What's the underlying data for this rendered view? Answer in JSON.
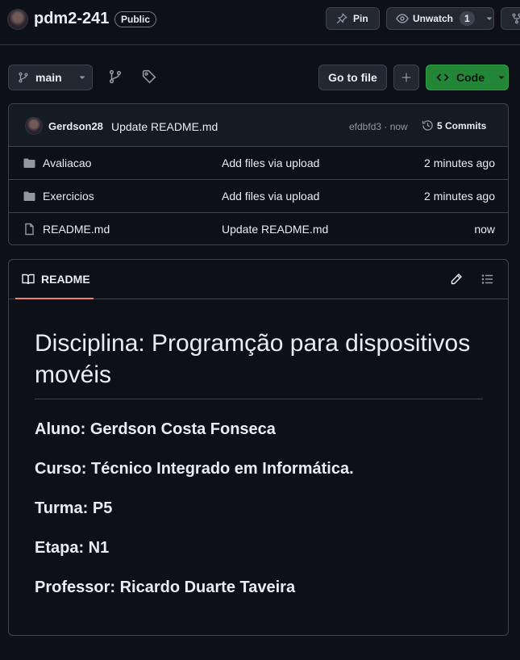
{
  "repo": {
    "name": "pdm2-241",
    "visibility": "Public"
  },
  "header_actions": {
    "pin_label": "Pin",
    "unwatch_label": "Unwatch",
    "watch_count": "1"
  },
  "toolbar": {
    "branch": "main",
    "go_to_file": "Go to file",
    "code_label": "Code"
  },
  "latest_commit": {
    "author": "Gerdson28",
    "message": "Update README.md",
    "hash_time": "efdbfd3 · now",
    "commits_label": "5 Commits"
  },
  "files": [
    {
      "name": "Avaliacao",
      "type": "folder",
      "commit": "Add files via upload",
      "time": "2 minutes ago"
    },
    {
      "name": "Exercicios",
      "type": "folder",
      "commit": "Add files via upload",
      "time": "2 minutes ago"
    },
    {
      "name": "README.md",
      "type": "file",
      "commit": "Update README.md",
      "time": "now"
    }
  ],
  "readme": {
    "tab_label": "README",
    "title": "Disciplina: Programção para dispositivos movéis",
    "lines": [
      "Aluno: Gerdson Costa Fonseca",
      "Curso: Técnico Integrado em Informática.",
      "Turma: P5",
      "Etapa: N1",
      "Professor: Ricardo Duarte Taveira"
    ]
  },
  "icons": {
    "pin": "pin-icon",
    "eye": "eye-icon",
    "caret": "caret-down-icon",
    "fork": "fork-icon",
    "branch": "git-branch-icon",
    "tag": "tag-icon",
    "plus": "plus-icon",
    "code": "code-icon",
    "history": "history-icon",
    "folder": "folder-icon",
    "file": "file-icon",
    "book": "book-icon",
    "pencil": "pencil-icon",
    "list": "list-unordered-icon"
  },
  "colors": {
    "background": "#0d1117",
    "accent_green": "#238636",
    "tab_underline": "#f78166",
    "muted_text": "#9198a1"
  }
}
